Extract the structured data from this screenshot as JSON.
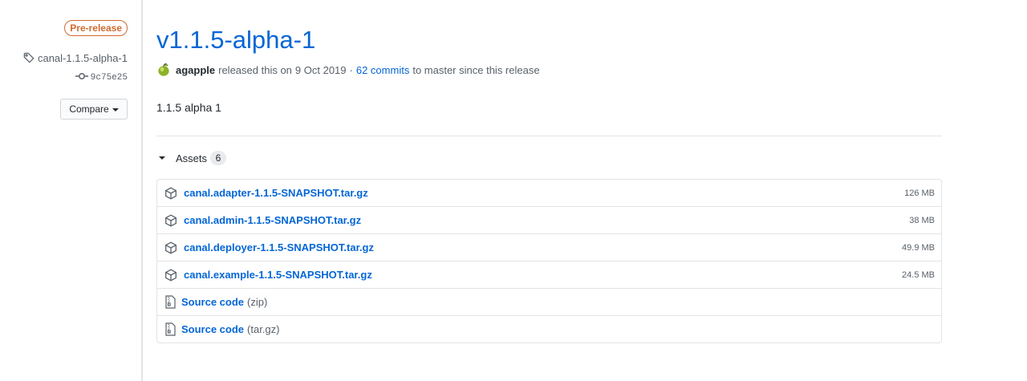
{
  "meta": {
    "prerelease_label": "Pre-release",
    "tag_name": "canal-1.1.5-alpha-1",
    "commit_sha": "9c75e25",
    "compare_label": "Compare"
  },
  "release": {
    "title": "v1.1.5-alpha-1",
    "author": "agapple",
    "released_text": "released this on",
    "date": "9 Oct 2019",
    "separator": "·",
    "commits_link": "62 commits",
    "commits_suffix": "to master since this release",
    "body": "1.1.5 alpha 1"
  },
  "assets": {
    "label": "Assets",
    "count": "6",
    "files": [
      {
        "name": "canal.adapter-1.1.5-SNAPSHOT.tar.gz",
        "size": "126 MB"
      },
      {
        "name": "canal.admin-1.1.5-SNAPSHOT.tar.gz",
        "size": "38 MB"
      },
      {
        "name": "canal.deployer-1.1.5-SNAPSHOT.tar.gz",
        "size": "49.9 MB"
      },
      {
        "name": "canal.example-1.1.5-SNAPSHOT.tar.gz",
        "size": "24.5 MB"
      }
    ],
    "source": [
      {
        "label": "Source code",
        "ext": "(zip)"
      },
      {
        "label": "Source code",
        "ext": "(tar.gz)"
      }
    ]
  },
  "colors": {
    "link": "#0366d6",
    "prerelease": "#d16b2e",
    "muted": "#586069",
    "border": "#e1e4e8"
  },
  "icons": [
    "tag-icon",
    "git-commit-icon",
    "package-icon",
    "file-zip-icon",
    "triangle-down-icon"
  ]
}
